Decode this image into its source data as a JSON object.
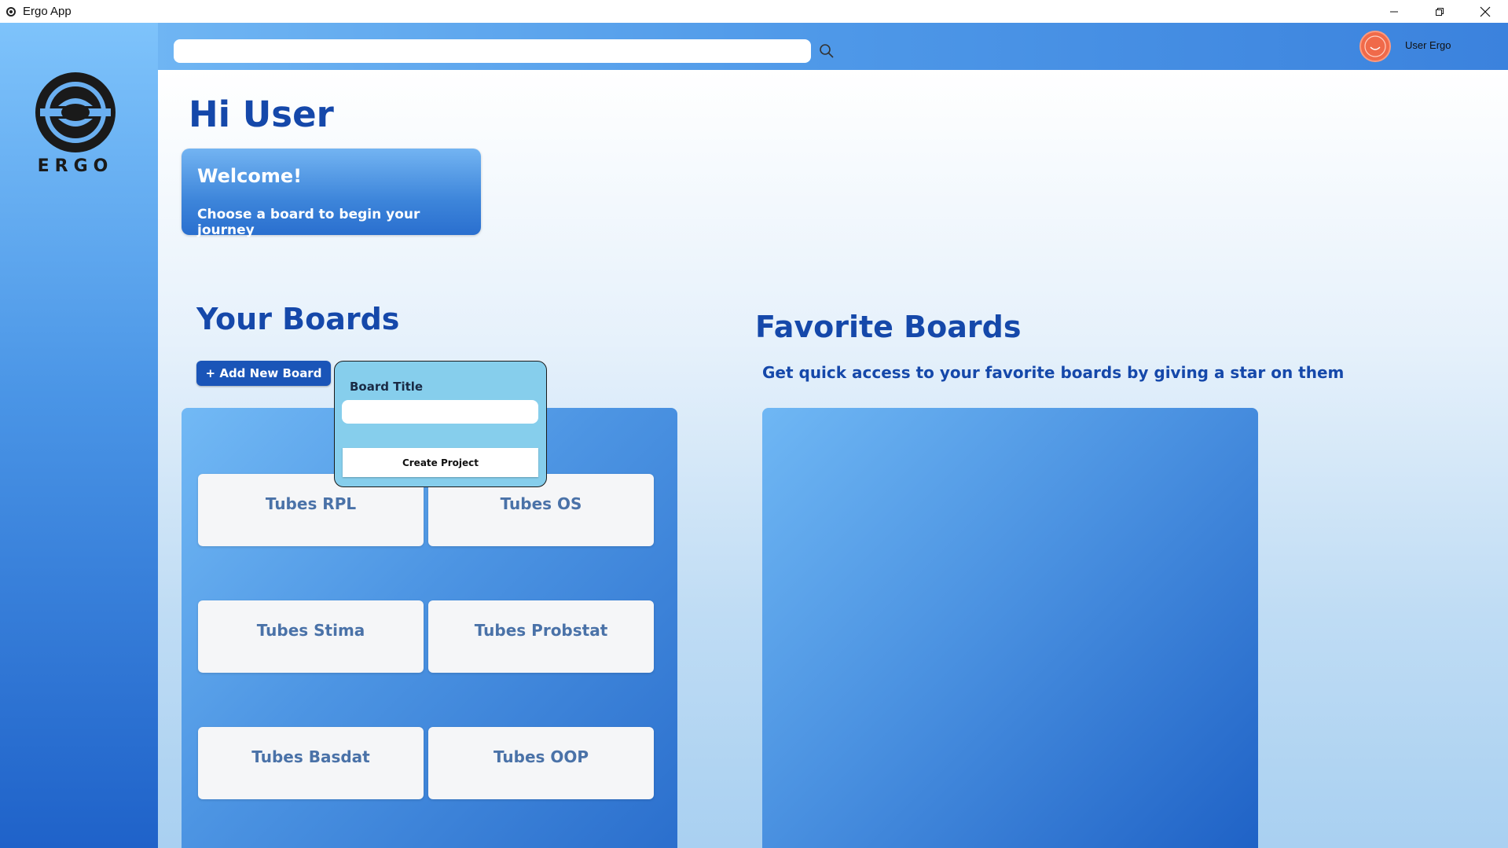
{
  "window": {
    "title": "Ergo App",
    "controls": [
      "minimize",
      "restore",
      "close"
    ]
  },
  "sidebar": {
    "logo_text": "ERGO"
  },
  "header": {
    "search": {
      "value": "",
      "placeholder": ""
    },
    "user": {
      "name": "User Ergo",
      "avatar_color": "#f06a4a"
    }
  },
  "main": {
    "greeting": "Hi User",
    "welcome": {
      "title": "Welcome!",
      "subtitle": "Choose a board to begin your journey"
    },
    "your_boards": {
      "title": "Your Boards",
      "add_button_label": "+ Add New Board",
      "boards": [
        {
          "label": "Tubes RPL"
        },
        {
          "label": "Tubes OS"
        },
        {
          "label": "Tubes Stima"
        },
        {
          "label": "Tubes Probstat"
        },
        {
          "label": "Tubes Basdat"
        },
        {
          "label": "Tubes OOP"
        }
      ]
    },
    "favorite_boards": {
      "title": "Favorite Boards",
      "description": "Get quick access to your favorite boards by giving a star on them"
    }
  },
  "new_board_popup": {
    "label": "Board Title",
    "input_value": "",
    "create_button_label": "Create Project"
  },
  "colors": {
    "accent_dark": "#1548aa",
    "primary_button": "#1a55b8",
    "popup_bg": "#86ceec"
  }
}
